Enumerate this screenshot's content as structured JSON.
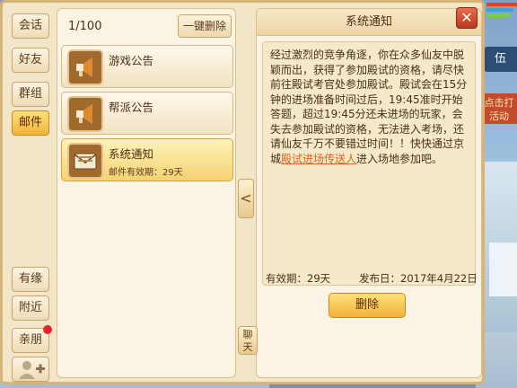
{
  "tabs": [
    {
      "label": "会话"
    },
    {
      "label": "好友"
    },
    {
      "label": "群组"
    },
    {
      "label": "邮件",
      "active": true
    }
  ],
  "bottom_tabs": [
    {
      "label": "有缘"
    },
    {
      "label": "附近"
    },
    {
      "label": "亲朋",
      "badge": true
    }
  ],
  "list": {
    "count": "1/100",
    "clear_all": "一键删除",
    "items": [
      {
        "title": "游戏公告",
        "subtitle": "",
        "icon": "megaphone-icon"
      },
      {
        "title": "帮派公告",
        "subtitle": "",
        "icon": "megaphone-icon"
      },
      {
        "title": "系统通知",
        "subtitle": "邮件有效期：29天",
        "icon": "envelope-icon",
        "selected": true
      }
    ]
  },
  "detail": {
    "title": "系统通知",
    "body_before_link": "经过激烈的竞争角逐，你在众多仙友中脱颖而出，获得了参加殿试的资格，请尽快前往殿试考官处参加殿试。殿试会在15分钟的进场准备时间过后，19:45准时开始答题，超过19:45分还未进场的玩家，会失去参加殿试的资格，无法进入考场，还请仙友千万不要错过时间！！快快通过京城",
    "link_text": "殿试进场传送人",
    "body_after_link": "进入场地参加吧。",
    "expiry": "有效期：29天",
    "published": "发布日：2017年4月22日",
    "delete_label": "删除"
  },
  "side_handle": "<",
  "chat_tab": "聊天",
  "hud": {
    "right_button_1": "伍",
    "right_button_2": "点击打活动"
  },
  "colors": {
    "accent": "#f2b43a",
    "link": "#e0651b",
    "close": "#b73a22"
  }
}
